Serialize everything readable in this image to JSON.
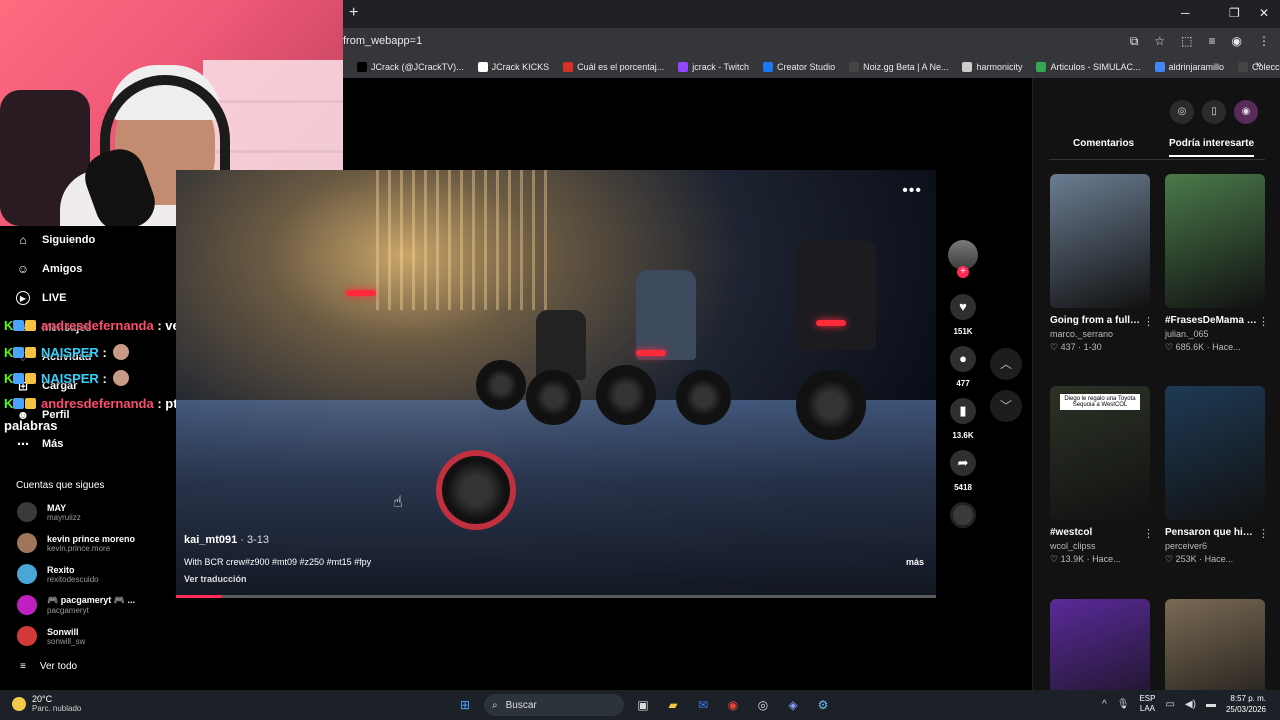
{
  "browser": {
    "new_tab": "+",
    "url": "from_webapp=1",
    "window_controls": [
      "─",
      "❐",
      "✕"
    ],
    "bookmarks": [
      {
        "label": "JCrack (@JCrackTV)...",
        "color": "#000000"
      },
      {
        "label": "JCrack KICKS",
        "color": "#ffffff"
      },
      {
        "label": "Cuál es el porcentaj...",
        "color": "#d93025"
      },
      {
        "label": "jcrack - Twitch",
        "color": "#9146ff"
      },
      {
        "label": "Creator Studio",
        "color": "#1877f2"
      },
      {
        "label": "Noiz.gg Beta | A Ne...",
        "color": "#444444"
      },
      {
        "label": "harmonicity",
        "color": "#cccccc"
      },
      {
        "label": "Articulos - SIMULAC...",
        "color": "#34a853"
      },
      {
        "label": "aldrinjaramillo",
        "color": "#4285f4"
      },
      {
        "label": "Colección de M_blei...",
        "color": "#444444"
      }
    ],
    "more": "»"
  },
  "sidebar": {
    "nav": [
      {
        "label": "Siguiendo",
        "icon": "following-icon"
      },
      {
        "label": "Amigos",
        "icon": "friends-icon"
      },
      {
        "label": "LIVE",
        "icon": "live-icon"
      },
      {
        "label": "Mensajes",
        "icon": "messages-icon"
      },
      {
        "label": "Actividad",
        "icon": "activity-icon"
      },
      {
        "label": "Cargar",
        "icon": "upload-icon"
      },
      {
        "label": "Perfil",
        "icon": "profile-icon"
      },
      {
        "label": "Más",
        "icon": "more-icon"
      }
    ],
    "following_title": "Cuentas que sigues",
    "accounts": [
      {
        "name": "MAY",
        "handle": "mayruiizz",
        "color": "#3a3a3a"
      },
      {
        "name": "kevin prince moreno",
        "handle": "kevin.prince.more",
        "color": "#a0765a"
      },
      {
        "name": "Rexito",
        "handle": "rexitodescuido",
        "color": "#49a7d8"
      },
      {
        "name": "🎮 pacgameryt 🎮 ...",
        "handle": "pacgameryt",
        "color": "#c020c0"
      },
      {
        "name": "Sonwill",
        "handle": "sonwill_sw",
        "color": "#d23a3a"
      }
    ],
    "see_all": "Ver todo"
  },
  "chat": [
    {
      "user": "andresdefernanda",
      "msg": ": vez*",
      "color": "#ff4d6d"
    },
    {
      "user": "NAISPER",
      "msg": ":",
      "color": "#36d1ff"
    },
    {
      "user": "NAISPER",
      "msg": ":",
      "color": "#36d1ff"
    },
    {
      "user": "andresdefernanda",
      "msg": ": pta me comí",
      "color": "#ff4d6d"
    }
  ],
  "chat_wrap": "palabras",
  "video": {
    "author": "kai_mt091",
    "date": " · 3-13",
    "caption": "With BCR crew#z900 #mt09 #z250 #mt15 #fpy",
    "translate": "Ver traducción",
    "more": "más",
    "menu": "•••",
    "progress": 0.06
  },
  "actions": {
    "likes": "151K",
    "comments": "477",
    "saves": "13.6K",
    "shares": "5418"
  },
  "right_panel": {
    "tabs": [
      "Comentarios",
      "Podría interesarte"
    ],
    "cards": [
      {
        "title": "Going from a full glass cockpit bac...",
        "user": "marco._serrano",
        "meta": "437 · 1-30",
        "thumb_color": "#6b7d92",
        "thumb_text": ""
      },
      {
        "title": "#FrasesDeMama #VoiceEffects...",
        "user": "julian._065",
        "meta": "685.6K · Hace...",
        "thumb_color": "#4a7a4a",
        "thumb_text": ""
      },
      {
        "title": "#westcol",
        "user": "wcol_clipss",
        "meta": "13.9K · Hace...",
        "thumb_color": "#2c3326",
        "thumb_text": "Diego le regalo una Toyota Sequoia a WestCOL"
      },
      {
        "title": "Pensaron que hizo trampa pero tení...",
        "user": "perceiver6",
        "meta": "253K · Hace...",
        "thumb_color": "#1e3a55",
        "thumb_text": ""
      },
      {
        "title": "",
        "user": "",
        "meta": "",
        "thumb_color": "#5a2a9a",
        "thumb_text": ""
      },
      {
        "title": "",
        "user": "",
        "meta": "",
        "thumb_color": "#7a6a55",
        "thumb_text": ""
      }
    ]
  },
  "taskbar": {
    "temp": "20°C",
    "condition": "Parc. nublado",
    "search": "Buscar",
    "lang1": "ESP",
    "lang2": "LAA",
    "time": "8:57 p. m.",
    "date": "25/03/2026"
  }
}
